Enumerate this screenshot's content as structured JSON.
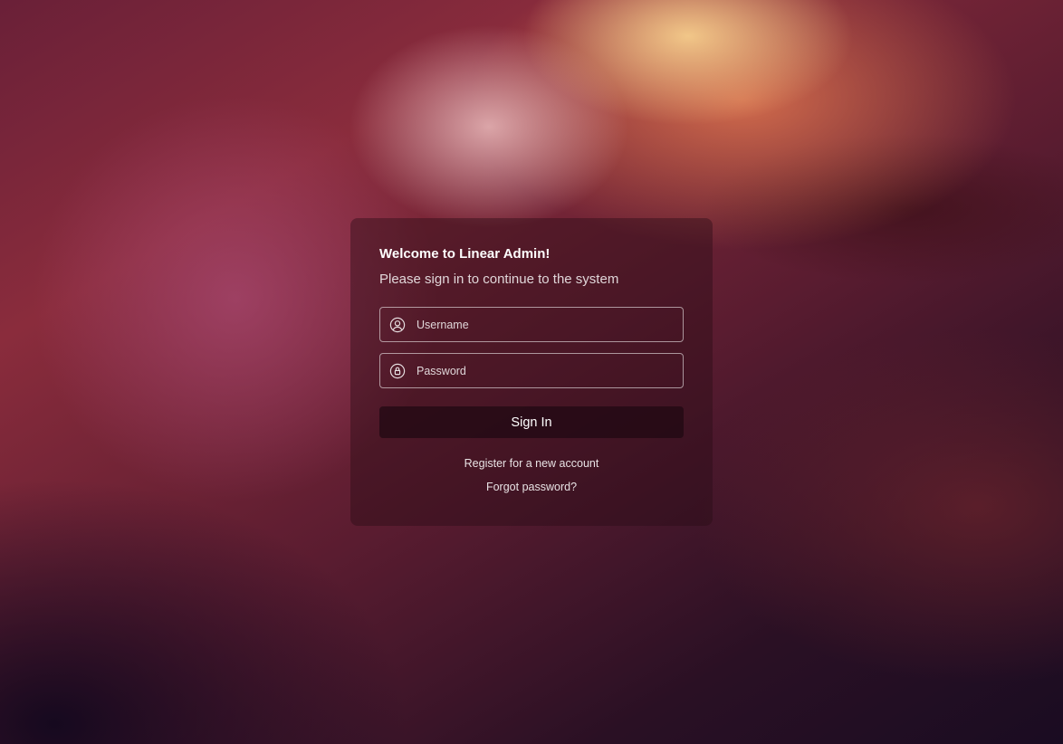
{
  "login": {
    "title": "Welcome to Linear Admin!",
    "subtitle": "Please sign in to continue to the system",
    "username": {
      "placeholder": "Username",
      "value": "",
      "icon": "user-circle-icon"
    },
    "password": {
      "placeholder": "Password",
      "value": "",
      "icon": "lock-circle-icon"
    },
    "signin_label": "Sign In",
    "register_link": "Register for a new account",
    "forgot_link": "Forgot password?"
  }
}
